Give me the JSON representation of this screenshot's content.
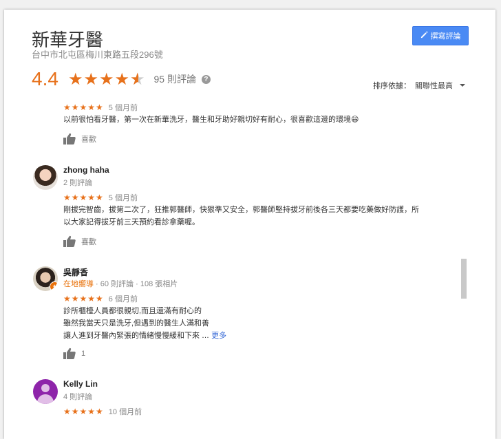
{
  "place": {
    "title": "新華牙醫",
    "address": "台中市北屯區梅川東路五段296號",
    "rating": "4.4",
    "stars": 4.4,
    "review_count": "95 則評論",
    "help_glyph": "?"
  },
  "write_review": {
    "label": "撰寫評論",
    "icon": "pencil-icon"
  },
  "sort": {
    "label": "排序依據：",
    "value": "關聯性最高"
  },
  "colors": {
    "accent": "#e7711b",
    "button": "#4a8af4",
    "link": "#3367d6"
  },
  "reviews": [
    {
      "stars": "★★★★★",
      "time": "5 個月前",
      "text": "以前很怕看牙醫，第一次在新華洗牙，醫生和牙助好親切好有耐心，很喜歡這邊的環境😄",
      "like_label": "喜歡"
    },
    {
      "name": "zhong haha",
      "meta": "2 則評論",
      "stars": "★★★★★",
      "time": "5 個月前",
      "text_lines": [
        "剛拔完智齒，拔第二次了，狂推郭醫師，快狠準又安全，郭醫師堅持拔牙前後各三天都要吃藥做好防護，所",
        "以大家記得拔牙前三天預約看診拿藥喔。"
      ],
      "like_label": "喜歡"
    },
    {
      "name": "吳靜香",
      "meta_guide": "在地嚮導",
      "meta_rest": " · 60 則評論 · 108 張相片",
      "stars": "★★★★★",
      "time": "6 個月前",
      "text_lines": [
        "診所櫃檯人員都很親切,而且還滿有耐心的",
        "雖然我當天只是洗牙,但遇到的醫生人滿和善",
        "讓人進到牙醫內緊張的情緒慢慢緩和下來 … "
      ],
      "more_label": "更多",
      "like_label": "1"
    },
    {
      "name": "Kelly Lin",
      "meta": "4 則評論",
      "stars": "★★★★★",
      "time": "10 個月前"
    }
  ]
}
